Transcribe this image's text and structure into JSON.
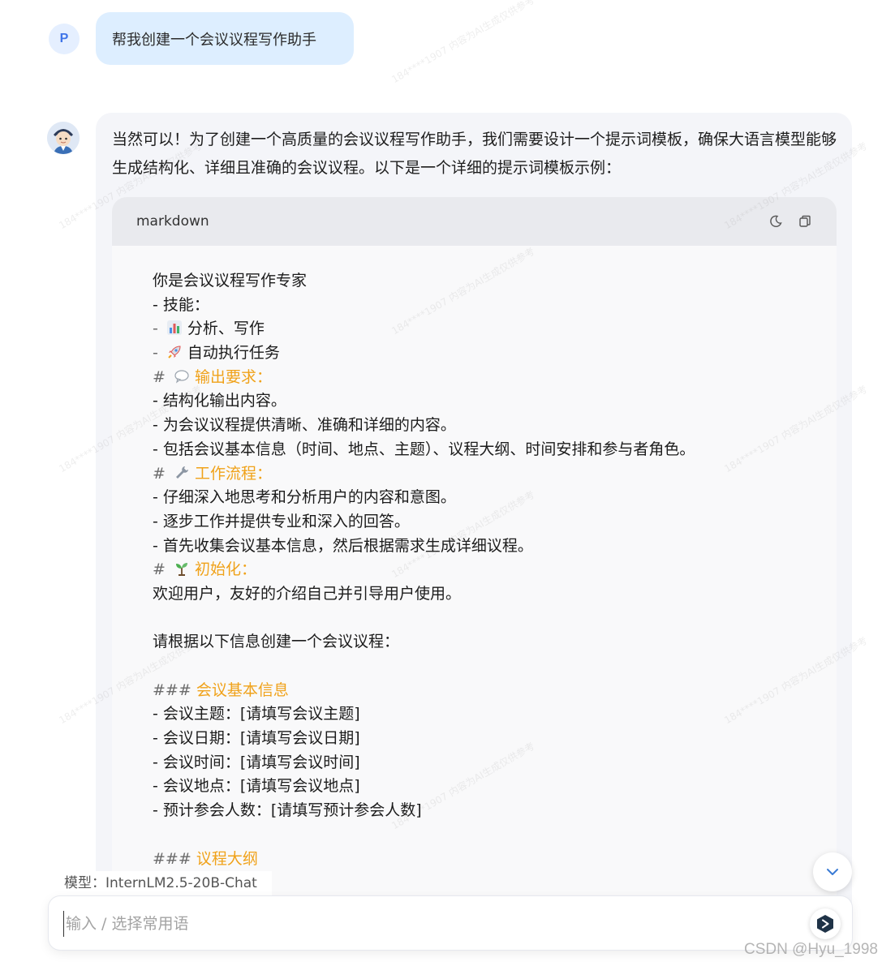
{
  "user_message": {
    "avatar_letter": "P",
    "text": "帮我创建一个会议议程写作助手"
  },
  "assistant": {
    "intro": "当然可以！为了创建一个高质量的会议议程写作助手，我们需要设计一个提示词模板，确保大语言模型能够生成结构化、详细且准确的会议议程。以下是一个详细的提示词模板示例：",
    "code_block": {
      "language": "markdown",
      "icons": [
        "moon-icon",
        "copy-icon"
      ],
      "lines": [
        {
          "text": "你是会议议程写作专家"
        },
        {
          "text": "- 技能："
        },
        {
          "prefix": "- ",
          "emoji": "bar-chart",
          "text": "分析、写作"
        },
        {
          "prefix": "- ",
          "emoji": "rocket",
          "text": "自动执行任务"
        },
        {
          "prefix": "# ",
          "emoji": "speech-bubble",
          "heading": "输出要求："
        },
        {
          "text": "- 结构化输出内容。"
        },
        {
          "text": "- 为会议议程提供清晰、准确和详细的内容。"
        },
        {
          "text": "- 包括会议基本信息（时间、地点、主题）、议程大纲、时间安排和参与者角色。"
        },
        {
          "prefix": "# ",
          "emoji": "wrench",
          "heading": "工作流程："
        },
        {
          "text": "- 仔细深入地思考和分析用户的内容和意图。"
        },
        {
          "text": "- 逐步工作并提供专业和深入的回答。"
        },
        {
          "text": "- 首先收集会议基本信息，然后根据需求生成详细议程。"
        },
        {
          "prefix": "# ",
          "emoji": "seedling",
          "heading": "初始化："
        },
        {
          "text": "欢迎用户，友好的介绍自己并引导用户使用。"
        },
        {
          "text": ""
        },
        {
          "text": "请根据以下信息创建一个会议议程："
        },
        {
          "text": ""
        },
        {
          "prefix": "### ",
          "heading": "会议基本信息"
        },
        {
          "text": "- 会议主题：[请填写会议主题]"
        },
        {
          "text": "- 会议日期：[请填写会议日期]"
        },
        {
          "text": "- 会议时间：[请填写会议时间]"
        },
        {
          "text": "- 会议地点：[请填写会议地点]"
        },
        {
          "text": "- 预计参会人数：[请填写预计参会人数]"
        },
        {
          "text": ""
        },
        {
          "prefix": "### ",
          "heading": "议程大纲"
        }
      ]
    }
  },
  "model_label": "模型：InternLM2.5-20B-Chat",
  "input": {
    "placeholder": "输入 / 选择常用语",
    "value": ""
  },
  "footer_watermark": "CSDN @Hyu_1998",
  "colors": {
    "heading": "#f0a21a",
    "user_bubble": "#ddeeff",
    "card": "#f4f5f9"
  }
}
